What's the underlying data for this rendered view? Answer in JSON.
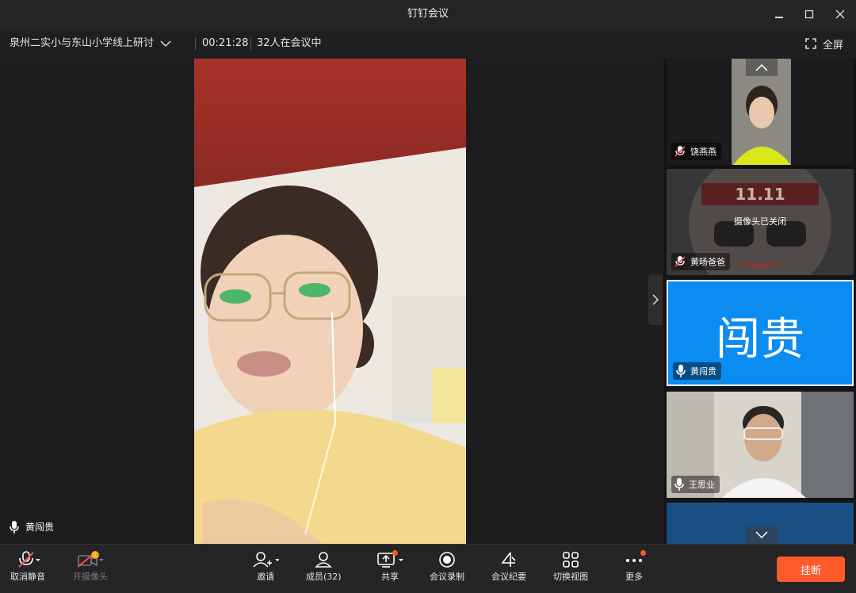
{
  "window": {
    "title": "钉钉会议"
  },
  "infobar": {
    "meeting_name": "泉州二实小与东山小学线上研讨",
    "elapsed": "00:21:28",
    "participants": "32人在会议中",
    "fullscreen_label": "全屏"
  },
  "main": {
    "speaker_name": "黄闯贵"
  },
  "sidebar": {
    "tiles": [
      {
        "name": "饶燕燕",
        "muted": true
      },
      {
        "name": "黄旸爸爸",
        "muted": true,
        "camera_off_text": "摄像头已关闭",
        "poster_text": "11.11"
      },
      {
        "name": "黄闯贵",
        "muted": false,
        "avatar_text": "闯贵"
      },
      {
        "name": "王思业",
        "muted": false
      }
    ]
  },
  "toolbar": {
    "unmute": "取消静音",
    "camera": "开摄像头",
    "invite": "邀请",
    "members": "成员(32)",
    "share": "共享",
    "record": "会议录制",
    "minutes": "会议纪要",
    "switch_view": "切换视图",
    "more": "更多",
    "hangup": "挂断"
  },
  "colors": {
    "accent": "#ff5a2a",
    "avatar_blue": "#0a8cf0"
  }
}
